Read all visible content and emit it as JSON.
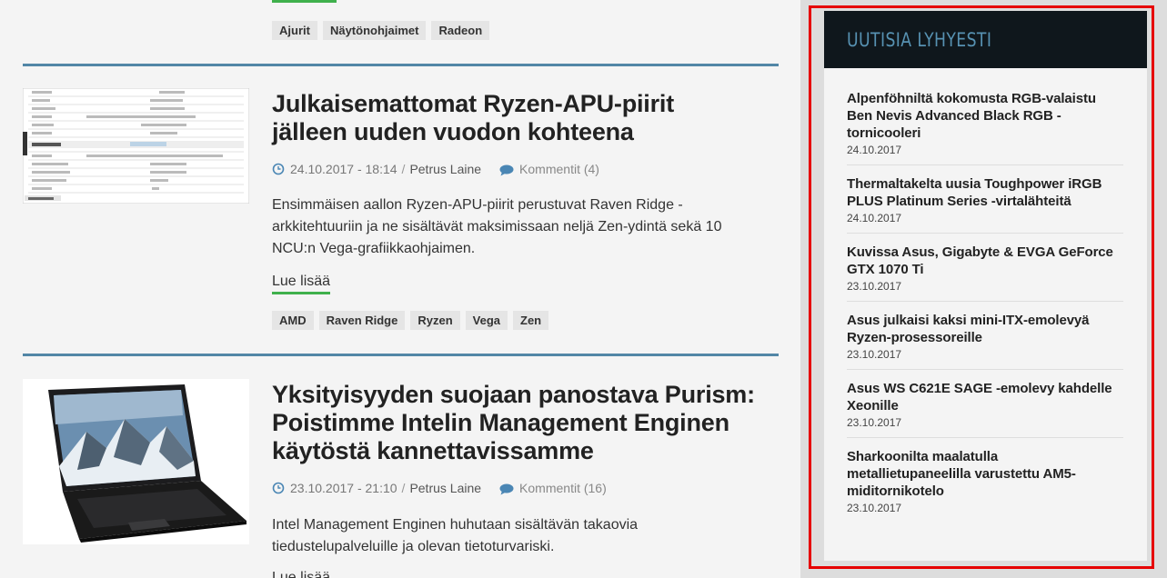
{
  "top_tags": [
    "Ajurit",
    "Näytönohjaimet",
    "Radeon"
  ],
  "articles": [
    {
      "title_lines": [
        "Julkaisemattomat Ryzen-APU-piirit",
        "jälleen uuden vuodon kohteena"
      ],
      "date": "24.10.2017 - 18:14",
      "author": "Petrus Laine",
      "comments": "Kommentit (4)",
      "excerpt": "Ensimmäisen aallon Ryzen-APU-piirit perustuvat Raven Ridge -arkkitehtuuriin ja ne sisältävät maksimissaan neljä Zen-ydintä sekä 10 NCU:n Vega-grafiikkaohjaimen.",
      "read_more": "Lue lisää",
      "tags": [
        "AMD",
        "Raven Ridge",
        "Ryzen",
        "Vega",
        "Zen"
      ]
    },
    {
      "title_lines": [
        "Yksityisyyden suojaan panostava Purism:",
        "Poistimme Intelin Management Enginen",
        "käytöstä kannettavissamme"
      ],
      "date": "23.10.2017 - 21:10",
      "author": "Petrus Laine",
      "comments": "Kommentit (16)",
      "excerpt": "Intel Management Enginen huhutaan sisältävän takaovia tiedustelupalveluille ja olevan tietoturvariski.",
      "read_more": "Lue lisää"
    }
  ],
  "sidebar": {
    "title": "UUTISIA LYHYESTI",
    "items": [
      {
        "title": "Alpenföhniltä kokomusta RGB-valaistu Ben Nevis Advanced Black RGB -tornicooleri",
        "date": "24.10.2017"
      },
      {
        "title": "Thermaltakelta uusia Toughpower iRGB PLUS Platinum Series -virtalähteitä",
        "date": "24.10.2017"
      },
      {
        "title": "Kuvissa Asus, Gigabyte & EVGA GeForce GTX 1070 Ti",
        "date": "23.10.2017"
      },
      {
        "title": "Asus julkaisi kaksi mini-ITX-emolevyä Ryzen-prosessoreille",
        "date": "23.10.2017"
      },
      {
        "title": "Asus WS C621E SAGE -emolevy kahdelle Xeonille",
        "date": "23.10.2017"
      },
      {
        "title": "Sharkoonilta maalatulla metallietupaneelilla varustettu AM5-miditornikotelo",
        "date": "23.10.2017"
      }
    ]
  },
  "colors": {
    "accent_green": "#3fb04c",
    "separator_blue": "#5286a6",
    "sidebar_header_bg": "#0f171c",
    "sidebar_header_text": "#5792b2",
    "highlight_red": "#e60000"
  }
}
